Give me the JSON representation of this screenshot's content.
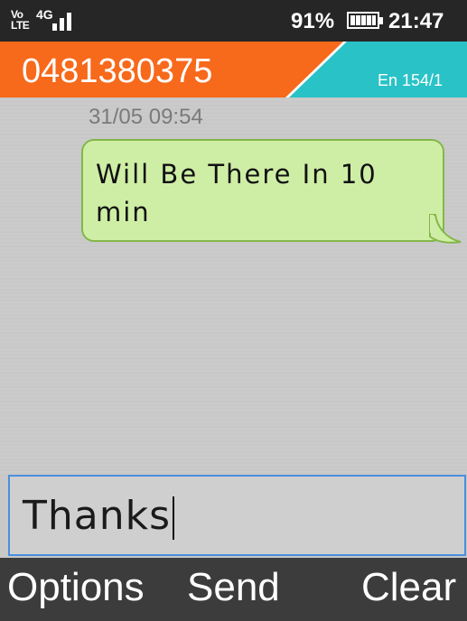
{
  "status_bar": {
    "volte_label": "Vo LTE",
    "network_label": "4G",
    "signal_icon": "signal-bars-icon",
    "battery_percent": "91%",
    "battery_level": 0.91,
    "battery_icon": "battery-icon",
    "time": "21:47"
  },
  "header": {
    "contact_number": "0481380375",
    "input_mode_counter": "En 154/1",
    "colors": {
      "primary": "#f7691b",
      "secondary": "#29c2c7"
    }
  },
  "conversation": {
    "messages": [
      {
        "timestamp": "31/05 09:54",
        "text": "Will Be There In 10 min",
        "bubble_color": "#cfeea5"
      }
    ]
  },
  "composer": {
    "value": "Thanks",
    "border_color": "#4a8fdc"
  },
  "softkeys": {
    "left": "Options",
    "center": "Send",
    "right": "Clear"
  }
}
